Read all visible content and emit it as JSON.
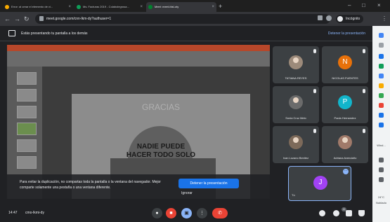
{
  "browser": {
    "tabs": [
      {
        "label": "Error: al crear el elemento de vi...",
        "icon_color": "#f9ab00"
      },
      {
        "label": "Ms. Facturas 2019 - Colabolegrosa...",
        "icon_color": "#0f9d58"
      },
      {
        "label": "Meet: meet-fdsl-oty",
        "icon_color": "#00832d"
      }
    ],
    "new_tab": "+",
    "url": "meet.google.com/cnn-lkm-dy?authuser=1",
    "profile_label": "Incógnito"
  },
  "banner": {
    "text": "Estás presentando tu pantalla a los demás",
    "stop_label": "Detener la presentación"
  },
  "presentation": {
    "slide_title": "GRACIAS",
    "slide_line1": "NADIE PUEDE",
    "slide_line2": "HACER TODO SOLO",
    "warning_text": "Para evitar la duplicación, no compartas toda la pantalla o la ventana del navegador. Mejor comparte solamente una pestaña o una ventana diferente.",
    "stop_button": "Detener la presentación",
    "ignore_label": "Ignorar"
  },
  "participants": [
    {
      "name": "TATIANA REYES",
      "type": "photo"
    },
    {
      "name": "NICOLAS FUENTES",
      "type": "avatar",
      "initial": "N",
      "color": "#e8710a"
    },
    {
      "name": "Sonia Cruz Melo",
      "type": "photo"
    },
    {
      "name": "Paola Hernandez",
      "type": "avatar",
      "initial": "P",
      "color": "#12b5cb"
    },
    {
      "name": "Ivan Lozano Benitez",
      "type": "photo"
    },
    {
      "name": "Adriana Avendaño",
      "type": "photo"
    }
  ],
  "self_tile": {
    "name": "Tú",
    "initial": "J",
    "color": "#a142f4"
  },
  "bottom": {
    "time": "14:47",
    "code": "cmo-lkmi-dy",
    "people_count": "8"
  },
  "side_strip": {
    "label1": "Wind...",
    "label2": "24°C",
    "label3": "Nublado"
  }
}
